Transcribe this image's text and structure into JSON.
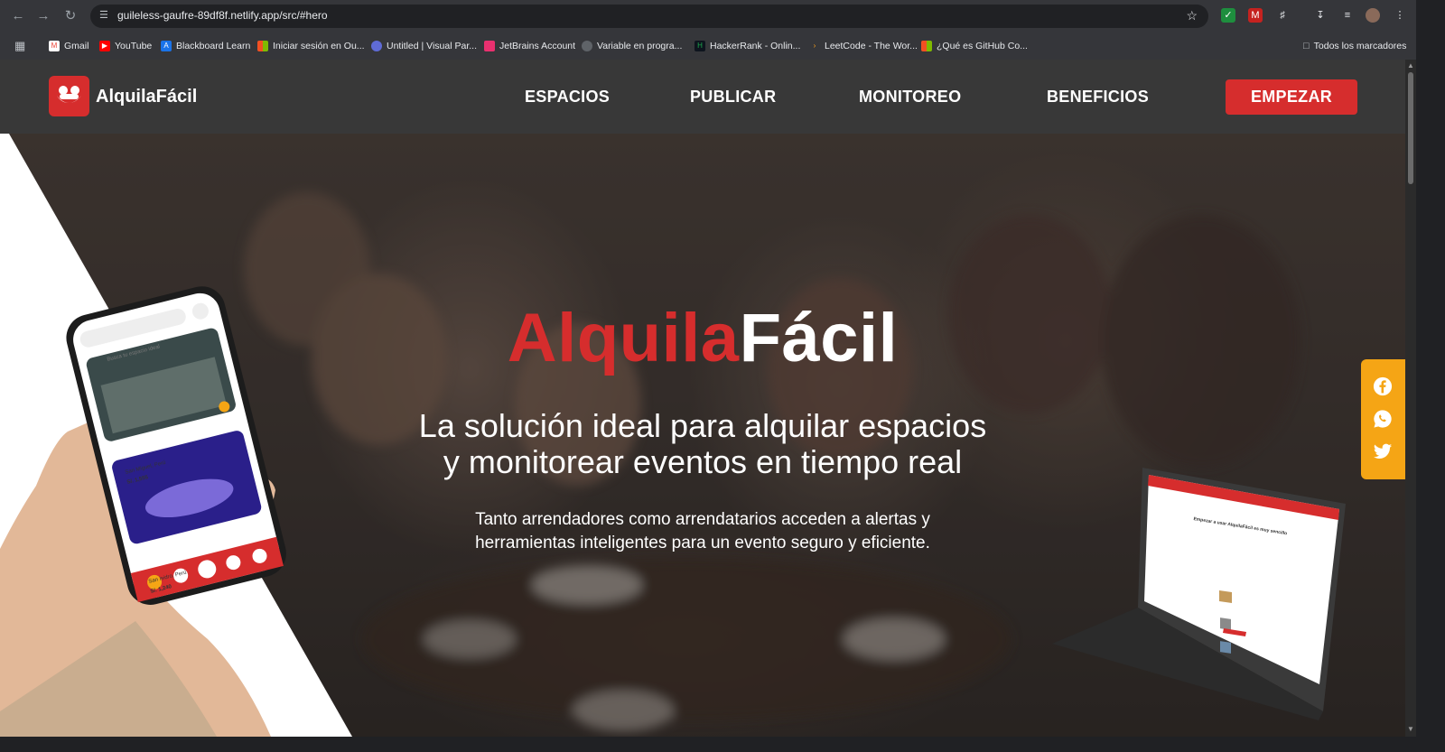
{
  "browser": {
    "url": "guileless-gaufre-89df8f.netlify.app/src/#hero",
    "bookmarks": [
      {
        "label": "Gmail",
        "icon": "gmail-icon",
        "color": "#ea4335"
      },
      {
        "label": "YouTube",
        "icon": "youtube-icon",
        "color": "#ff0000"
      },
      {
        "label": "Blackboard Learn",
        "icon": "blackboard-icon",
        "color": "#1a73e8"
      },
      {
        "label": "Iniciar sesión en Ou...",
        "icon": "microsoft-icon",
        "color": "#f25022"
      },
      {
        "label": "Untitled | Visual Par...",
        "icon": "visual-paradigm-icon",
        "color": "#5f6bd6"
      },
      {
        "label": "JetBrains Account",
        "icon": "jetbrains-icon",
        "color": "#e9306f"
      },
      {
        "label": "Variable en progra...",
        "icon": "globe-icon",
        "color": "#9aa0a6"
      },
      {
        "label": "HackerRank - Onlin...",
        "icon": "hackerrank-icon",
        "color": "#1ba94c"
      },
      {
        "label": "LeetCode - The Wor...",
        "icon": "leetcode-icon",
        "color": "#f89f1b"
      },
      {
        "label": "¿Qué es GitHub Co...",
        "icon": "microsoft-icon",
        "color": "#7fba00"
      }
    ],
    "all_bookmarks_label": "Todos los marcadores"
  },
  "site": {
    "logo_text": "AlquilaFácil",
    "nav": [
      "ESPACIOS",
      "PUBLICAR",
      "MONITOREO",
      "BENEFICIOS"
    ],
    "cta": "EMPEZAR",
    "brand_colors": {
      "red": "#d62d2d",
      "social_bar": "#f5a515"
    }
  },
  "hero": {
    "title_part1": "Alquila",
    "title_part2": "Fácil",
    "subtitle_line1": "La solución ideal para alquilar espacios",
    "subtitle_line2": "y monitorear eventos en tiempo real",
    "desc_line1": "Tanto arrendadores como arrendatarios acceden a alertas y",
    "desc_line2": "herramientas inteligentes para un evento seguro y eficiente."
  },
  "phone_mock": {
    "search_placeholder": "Busca tu espacio ideal",
    "card1_location": "San Miguel, Perú",
    "card1_price": "S/. 1,555",
    "card2_location": "San Isidro, Perú",
    "card2_price": "S/. 1,240"
  },
  "laptop_mock": {
    "heading": "Empezar a usar AlquilaFácil es muy sencillo"
  },
  "social": [
    "facebook-icon",
    "whatsapp-icon",
    "twitter-icon"
  ]
}
